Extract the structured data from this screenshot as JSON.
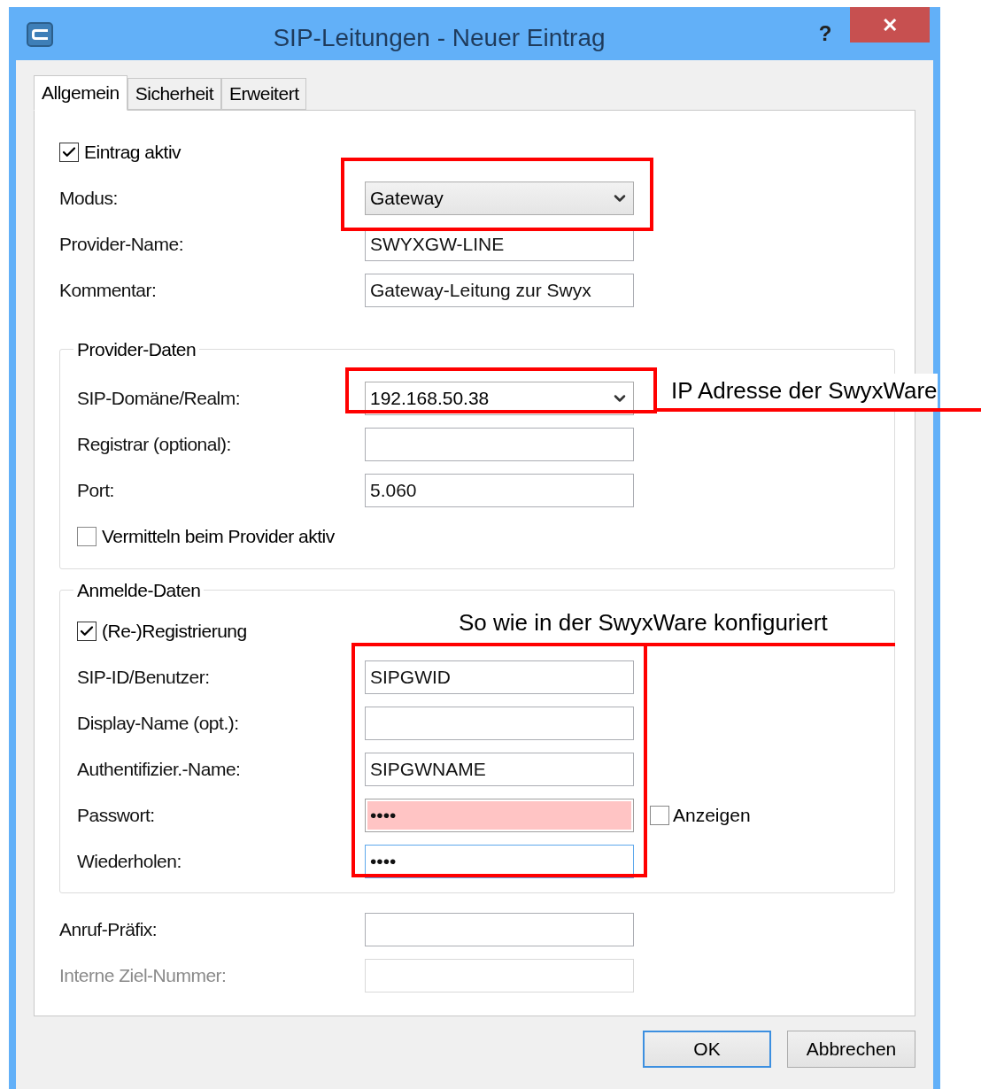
{
  "window": {
    "title": "SIP-Leitungen - Neuer Eintrag",
    "help": "?",
    "close": "✕"
  },
  "tabs": [
    {
      "label": "Allgemein",
      "selected": true
    },
    {
      "label": "Sicherheit",
      "selected": false
    },
    {
      "label": "Erweitert",
      "selected": false
    }
  ],
  "top_rows": [
    {
      "kind": "checkbox",
      "label": "Eintrag aktiv",
      "checked": true
    },
    {
      "kind": "dropdown",
      "label": "Modus:",
      "value": "Gateway",
      "editable": false
    },
    {
      "kind": "text",
      "label": "Provider-Name:",
      "value": "SWYXGW-LINE"
    },
    {
      "kind": "text",
      "label": "Kommentar:",
      "value": "Gateway-Leitung zur Swyx"
    }
  ],
  "groups": [
    {
      "title": "Provider-Daten",
      "rows": [
        {
          "kind": "dropdown",
          "label": "SIP-Domäne/Realm:",
          "value": "192.168.50.38",
          "editable": true
        },
        {
          "kind": "text",
          "label": "Registrar (optional):"
        },
        {
          "kind": "text",
          "label": "Port:",
          "value": "5.060"
        },
        {
          "kind": "checkbox",
          "label": "Vermitteln beim Provider aktiv",
          "checked": false
        }
      ]
    },
    {
      "title": "Anmelde-Daten",
      "rows": [
        {
          "kind": "checkbox",
          "label": "(Re-)Registrierung",
          "checked": true
        },
        {
          "kind": "text",
          "label": "SIP-ID/Benutzer:",
          "value": "SIPGWID"
        },
        {
          "kind": "text",
          "label": "Display-Name (opt.):"
        },
        {
          "kind": "text",
          "label": "Authentifizier.-Name:",
          "value": "SIPGWNAME"
        },
        {
          "kind": "password",
          "label": "Passwort:",
          "value": "••••",
          "error": true,
          "focused": false,
          "show": {
            "label": "Anzeigen",
            "checked": false
          }
        },
        {
          "kind": "password",
          "label": "Wiederholen:",
          "value": "••••",
          "error": false,
          "focused": true
        }
      ]
    }
  ],
  "bottom_rows": [
    {
      "kind": "text",
      "label": "Anruf-Präfix:",
      "disabled": false
    },
    {
      "kind": "text",
      "label": "Interne Ziel-Nummer:",
      "disabled": true
    }
  ],
  "buttons": [
    {
      "label": "OK",
      "default": true
    },
    {
      "label": "Abbrechen",
      "default": false
    }
  ],
  "annotations": [
    {
      "text": "IP Adresse der SwyxWare"
    },
    {
      "text": "So wie in der SwyxWare konfiguriert"
    }
  ]
}
